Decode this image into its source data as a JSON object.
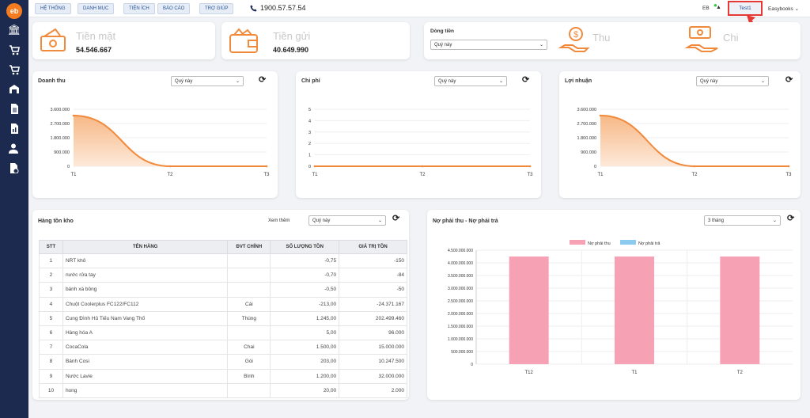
{
  "logo": "eb",
  "sidebar": {
    "icons": [
      "bank-icon",
      "cart-in-icon",
      "cart-out-icon",
      "warehouse-icon",
      "document-icon",
      "report-icon",
      "users-icon",
      "invoice-icon"
    ]
  },
  "topbar": {
    "menu": [
      "HỆ THỐNG",
      "DANH MỤC",
      "TIỆN ÍCH",
      "BÁO CÁO",
      "TRỢ GIÚP"
    ],
    "hotline": "1900.57.57.54",
    "flag": "EB",
    "user": "Test1",
    "company": "Easybooks"
  },
  "stats": {
    "cash": {
      "label": "Tiền mặt",
      "value": "54.546.667"
    },
    "deposit": {
      "label": "Tiền gửi",
      "value": "40.649.990"
    },
    "cashflow": {
      "title": "Dòng tiền",
      "period": "Quý này",
      "in_label": "Thu",
      "out_label": "Chi"
    }
  },
  "charts": [
    {
      "title": "Doanh thu",
      "period": "Quý này"
    },
    {
      "title": "Chi phí",
      "period": "Quý này"
    },
    {
      "title": "Lợi nhuận",
      "period": "Quý này"
    }
  ],
  "chart_data": [
    {
      "type": "area",
      "x": [
        "T1",
        "T2",
        "T3"
      ],
      "values": [
        3200000,
        0,
        0
      ],
      "yticks": [
        "3.600.000",
        "2.700.000",
        "1.800.000",
        "900.000",
        "0"
      ],
      "ylim": [
        0,
        3600000
      ],
      "color": "#f28a3c"
    },
    {
      "type": "line",
      "x": [
        "T1",
        "T2",
        "T3"
      ],
      "values": [
        0,
        0,
        0
      ],
      "yticks": [
        "5",
        "4",
        "3",
        "2",
        "1",
        "0"
      ],
      "ylim": [
        0,
        5
      ],
      "color": "#f28a3c"
    },
    {
      "type": "area",
      "x": [
        "T1",
        "T2",
        "T3"
      ],
      "values": [
        3200000,
        0,
        0
      ],
      "yticks": [
        "3.600.000",
        "2.700.000",
        "1.800.000",
        "900.000",
        "0"
      ],
      "ylim": [
        0,
        3600000
      ],
      "color": "#f28a3c"
    },
    {
      "type": "bar",
      "categories": [
        "T12",
        "T1",
        "T2"
      ],
      "series": [
        {
          "name": "Nợ phải thu",
          "values": [
            4250000000,
            4250000000,
            4250000000
          ],
          "color": "#f7a1b5"
        },
        {
          "name": "Nợ phải trả",
          "values": [
            0,
            0,
            0
          ],
          "color": "#8ccaf0"
        }
      ],
      "yticks": [
        "4.500.000.000",
        "4.000.000.000",
        "3.500.000.000",
        "3.000.000.000",
        "2.500.000.000",
        "2.000.000.000",
        "1.500.000.000",
        "1.000.000.000",
        "500.000.000",
        "0"
      ],
      "ylim": [
        0,
        4500000000
      ],
      "legend": "top"
    }
  ],
  "inventory": {
    "title": "Hàng tồn kho",
    "more_label": "Xem thêm",
    "period": "Quý này",
    "columns": [
      "STT",
      "TÊN HÀNG",
      "ĐVT CHÍNH",
      "SỐ LƯỢNG TỒN",
      "GIÁ TRỊ TỒN"
    ],
    "rows": [
      [
        "1",
        "NRT khô",
        "",
        "-0,75",
        "-150"
      ],
      [
        "2",
        "nước rửa tay",
        "",
        "-0,70",
        "-84"
      ],
      [
        "3",
        "bánh xà bông",
        "",
        "-0,50",
        "-50"
      ],
      [
        "4",
        "Chuột Coolerplus FC122/FC112",
        "Cái",
        "-213,00",
        "-24.371.167"
      ],
      [
        "5",
        "Cung Đình Hủ Tiếu Nam Vang Thố",
        "Thùng",
        "1.245,00",
        "202.499.460"
      ],
      [
        "6",
        "Hàng hóa A",
        "",
        "5,00",
        "96.000"
      ],
      [
        "7",
        "CocaCola",
        "Chai",
        "1.500,00",
        "15.000.000"
      ],
      [
        "8",
        "Bánh Cosi",
        "Gói",
        "203,00",
        "10.247.500"
      ],
      [
        "9",
        "Nước Lavie",
        "Bình",
        "1.200,00",
        "32.000.000"
      ],
      [
        "10",
        "hong",
        "",
        "20,00",
        "2.000"
      ]
    ]
  },
  "debt": {
    "title": "Nợ phải thu - Nợ phải trả",
    "period": "3 tháng"
  }
}
